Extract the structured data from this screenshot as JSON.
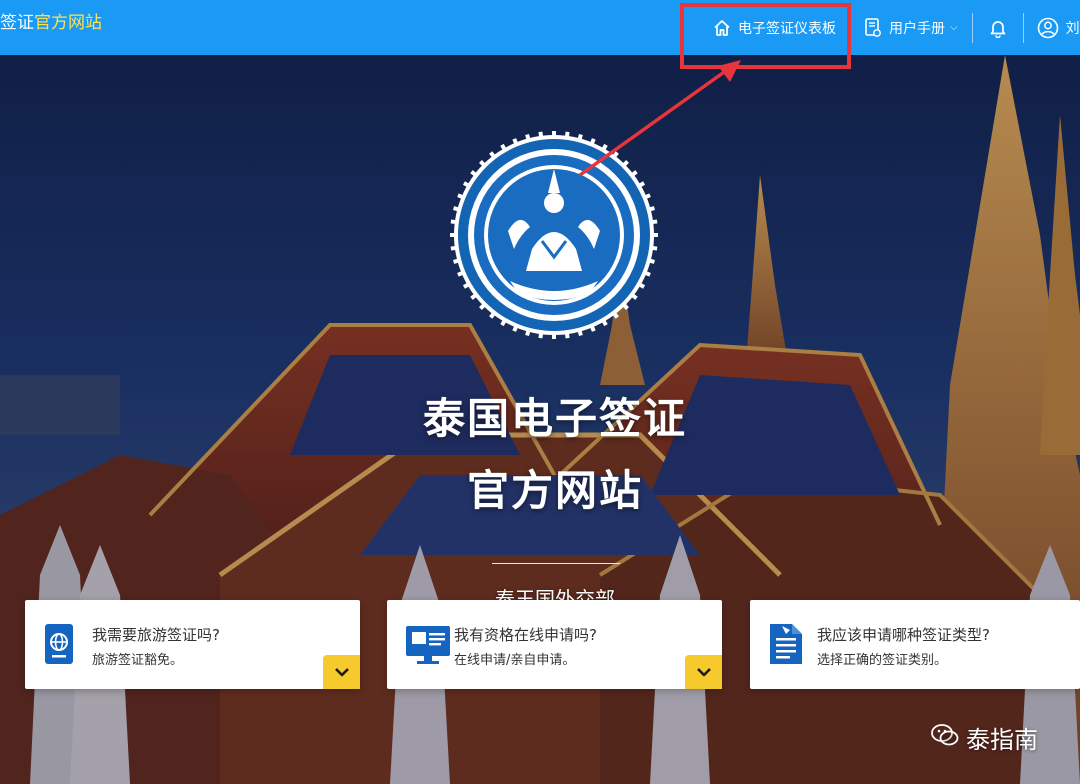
{
  "header": {
    "brand_prefix": "签证",
    "brand_accent": "官方网站",
    "nav": {
      "dashboard": "电子签证仪表板",
      "manual": "用户手册",
      "manual_chevron": "⌵",
      "user_initial": "刘"
    }
  },
  "hero": {
    "title_line1": "泰国电子签证",
    "title_line2": "官方网站",
    "ministry": "泰王国外交部"
  },
  "cards": [
    {
      "question": "我需要旅游签证吗?",
      "answer": "旅游签证豁免。",
      "icon": "passport-icon"
    },
    {
      "question": "我有资格在线申请吗?",
      "answer": "在线申请/亲自申请。",
      "icon": "monitor-icon"
    },
    {
      "question": "我应该申请哪种签证类型?",
      "answer": "选择正确的签证类别。",
      "icon": "document-icon"
    }
  ],
  "watermark": "泰指南",
  "colors": {
    "header_blue": "#1a9af5",
    "brand_accent": "#ffe14d",
    "highlight_red": "#e8353b",
    "toggle_yellow": "#f6c92d",
    "icon_blue": "#1565c0"
  }
}
